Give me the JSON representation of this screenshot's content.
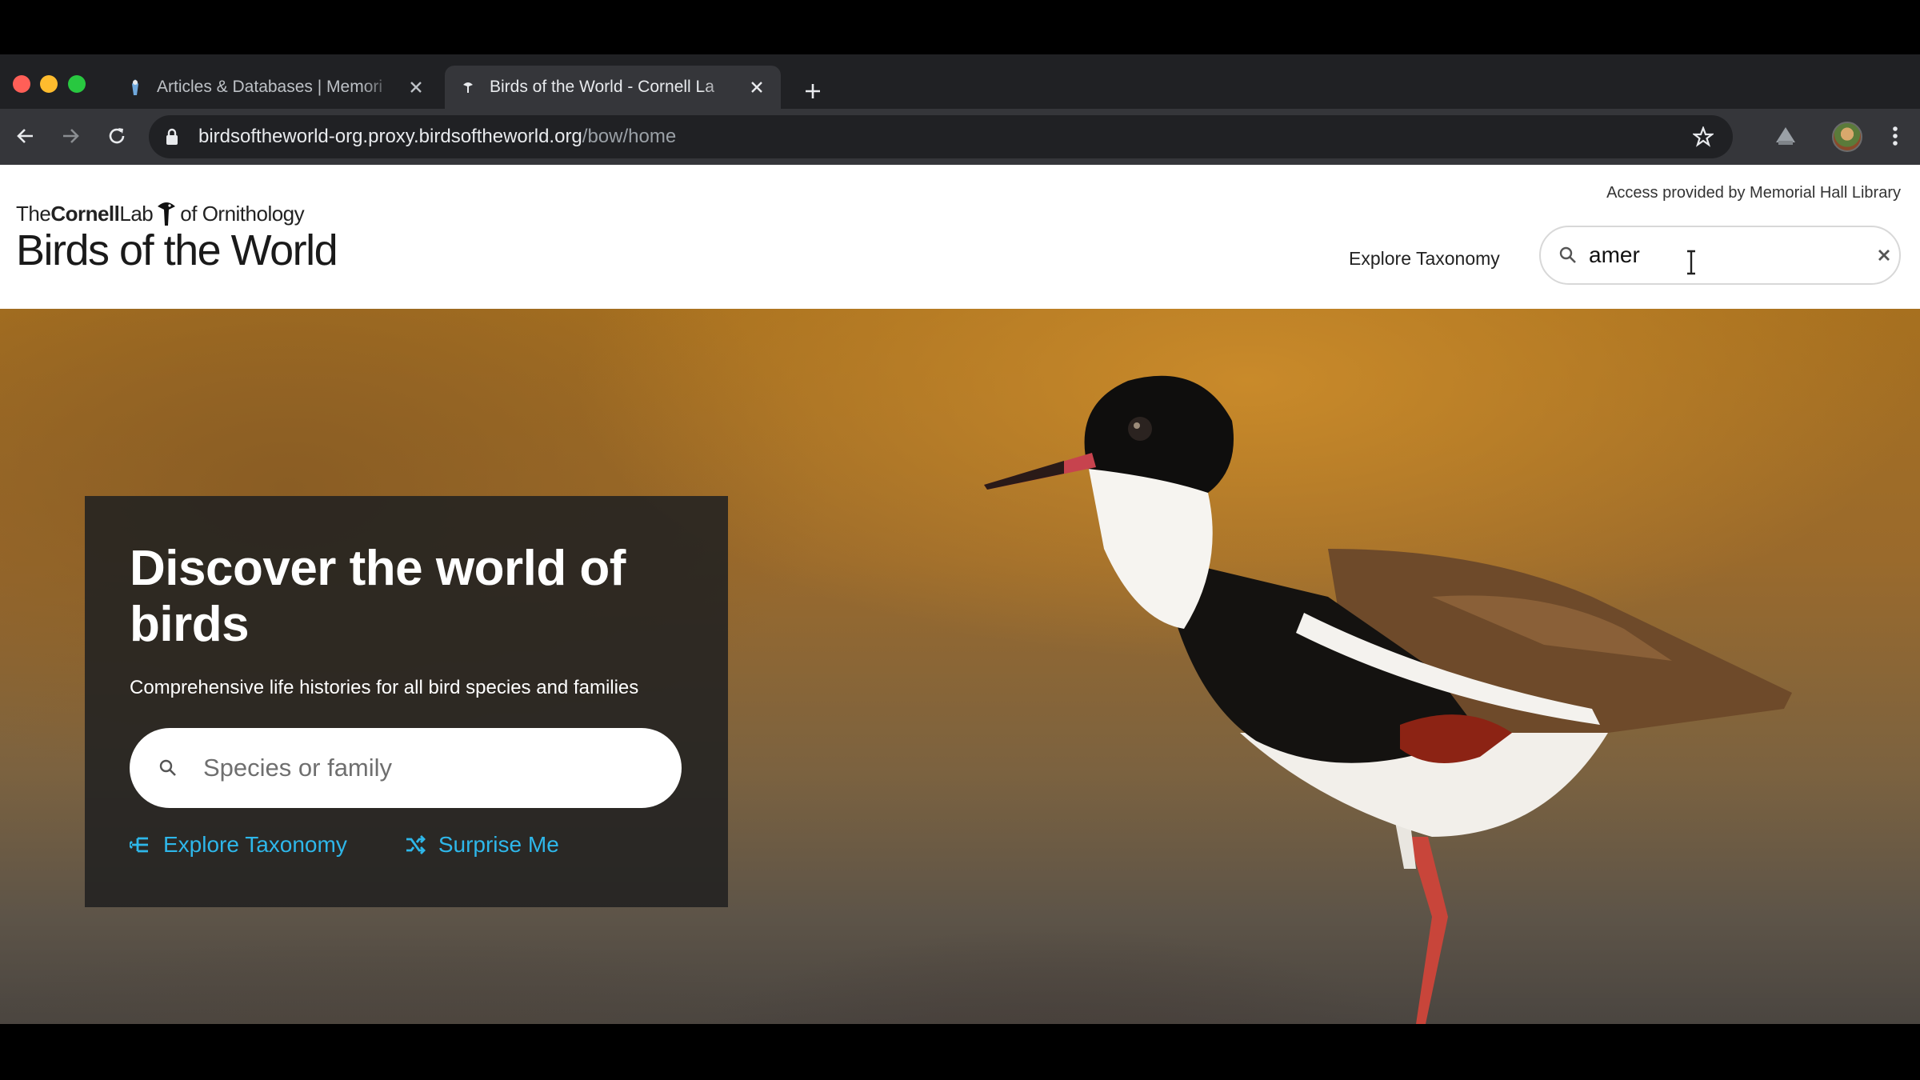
{
  "browser": {
    "tabs": [
      {
        "title": "Articles & Databases | Memori",
        "active": false
      },
      {
        "title": "Birds of the World - Cornell La",
        "active": true
      }
    ],
    "url_host": "birdsoftheworld-org.proxy.birdsoftheworld.org",
    "url_path": "/bow/home"
  },
  "header": {
    "logo_the": "The",
    "logo_cornell": "Cornell",
    "logo_lab": "Lab",
    "logo_of_ornithology": "of Ornithology",
    "logo_main": "Birds of the World",
    "access_text": "Access provided by Memorial Hall Library",
    "explore_label": "Explore Taxonomy",
    "search_value": "amer"
  },
  "hero": {
    "heading": "Discover the world of birds",
    "subheading": "Comprehensive life histories for all bird species and families",
    "search_placeholder": "Species or family",
    "explore_link": "Explore Taxonomy",
    "surprise_link": "Surprise Me"
  },
  "colors": {
    "accent_link": "#2eb7ea",
    "chrome_dark": "#202124",
    "chrome_toolbar": "#35363a"
  }
}
